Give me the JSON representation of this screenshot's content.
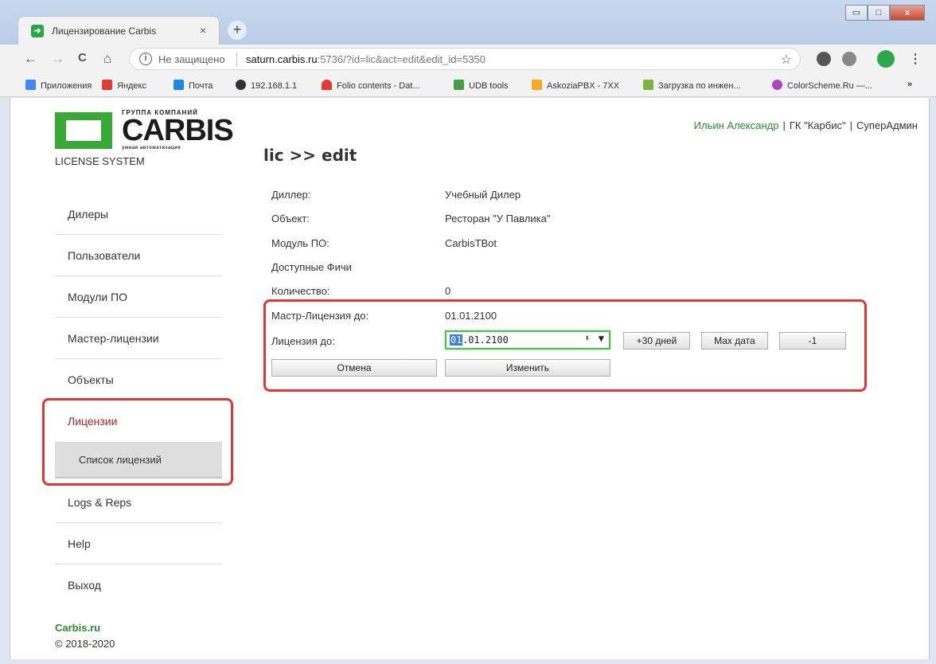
{
  "browser": {
    "tab_title": "Лицензирование Carbis",
    "tab_close": "×",
    "new_tab": "+",
    "window_controls": {
      "minimize": "▭",
      "maximize": "□",
      "close": "x"
    },
    "nav": {
      "back": "←",
      "forward": "→",
      "reload": "C",
      "home": "⌂"
    },
    "address": {
      "info": "i",
      "insecure_label": "Не защищено",
      "host": "saturn.carbis.ru",
      "rest": ":5736/?id=lic&act=edit&edit_id=5350"
    },
    "star": "☆",
    "menu": "⋮",
    "bookmarks": [
      {
        "label": "Приложения",
        "color": "#4285f4"
      },
      {
        "label": "Яндекс",
        "color": "#e53935"
      },
      {
        "label": "Почта",
        "color": "#1e88e5"
      },
      {
        "label": "192.168.1.1",
        "color": "#333333"
      },
      {
        "label": "Folio contents - Dat...",
        "color": "#e53935"
      },
      {
        "label": "UDB tools",
        "color": "#43a047"
      },
      {
        "label": "AskoziaPBX - 7XX",
        "color": "#f9a825"
      },
      {
        "label": "Загрузка по инжен...",
        "color": "#7cb342"
      },
      {
        "label": "ColorScheme.Ru —...",
        "color": "#ab47bc"
      }
    ],
    "bookmarks_more": "»"
  },
  "header": {
    "logo": {
      "group": "ГРУППА КОМПАНИЙ",
      "brand": "CARBIS",
      "tagline": "умная автоматизация"
    },
    "subtitle": "LICENSE SYSTEM",
    "user": "Ильин Александр",
    "org": "ГК \"Карбис\"",
    "role": "СуперАдмин",
    "separator": "|",
    "breadcrumb": "lic >> edit"
  },
  "sidebar": {
    "items": [
      "Дилеры",
      "Пользователи",
      "Модули ПО",
      "Мастер-лицензии",
      "Объекты",
      "Лицензии"
    ],
    "active_sub": "Список лицензий",
    "after": [
      "Logs & Reps",
      "Help",
      "Выход"
    ]
  },
  "footer": {
    "link": "Carbis.ru",
    "copyright": "© 2018-2020"
  },
  "form": {
    "fields": [
      {
        "label": "Диллер:",
        "value": "Учебный Дилер"
      },
      {
        "label": "Объект:",
        "value": "Ресторан \"У Павлика\""
      },
      {
        "label": "Модуль ПО:",
        "value": "CarbisTBot"
      },
      {
        "label": "Доступные Фичи",
        "value": ""
      },
      {
        "label": "Количество:",
        "value": "0"
      },
      {
        "label": "Мастр-Лицензия до:",
        "value": "01.01.2100"
      }
    ],
    "license_label": "Лицензия до:",
    "license_value_selected": "01",
    "license_value_rest": ".01.2100",
    "spin": "⬍",
    "drop": "▼",
    "btn_plus30": "+30 дней",
    "btn_max": "Max дата",
    "btn_minus1": "-1",
    "btn_cancel": "Отмена",
    "btn_change": "Изменить"
  }
}
